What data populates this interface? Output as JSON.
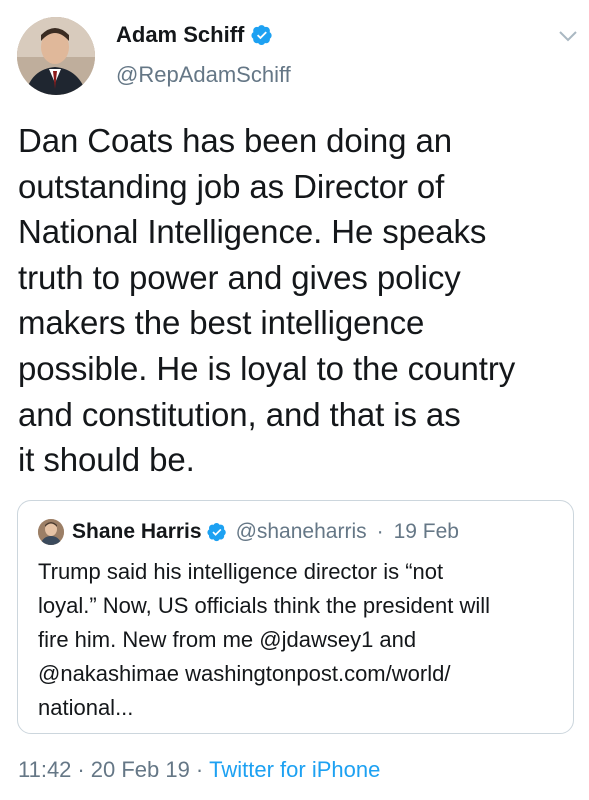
{
  "author": {
    "name": "Adam Schiff",
    "handle": "@RepAdamSchiff"
  },
  "tweet": {
    "lines": [
      "Dan Coats has been doing an",
      "outstanding job as Director of",
      "National Intelligence. He speaks",
      "truth to power and gives policy",
      "makers the best intelligence",
      "possible. He is loyal to the country",
      "and constitution, and that is as",
      "it should be."
    ]
  },
  "quoted_tweet": {
    "name": "Shane Harris",
    "handle": "@shaneharris",
    "separator": "·",
    "date": "19 Feb",
    "lines": [
      "Trump said his intelligence director is “not",
      "loyal.” Now, US officials think the president will",
      "fire him. New from me @jdawsey1 and",
      "@nakashimae  washingtonpost.com/world/",
      "national..."
    ]
  },
  "footer": {
    "time": "11:42",
    "date": "20 Feb 19",
    "source": "Twitter for iPhone",
    "separator": "·"
  },
  "colors": {
    "verified": "#1da1f2",
    "link": "#1da1f2",
    "secondary_text": "#657786",
    "border": "#ccd6dd"
  },
  "icons": {
    "verified": "verified-badge-icon",
    "menu": "chevron-down-icon"
  }
}
